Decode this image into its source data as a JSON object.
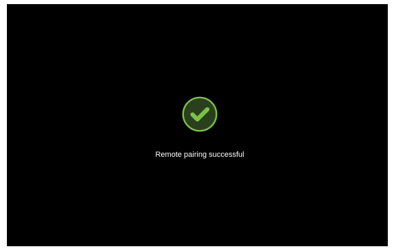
{
  "status": {
    "icon": "check-circle-icon",
    "accent_color": "#7cc04a",
    "message": "Remote pairing successful"
  }
}
